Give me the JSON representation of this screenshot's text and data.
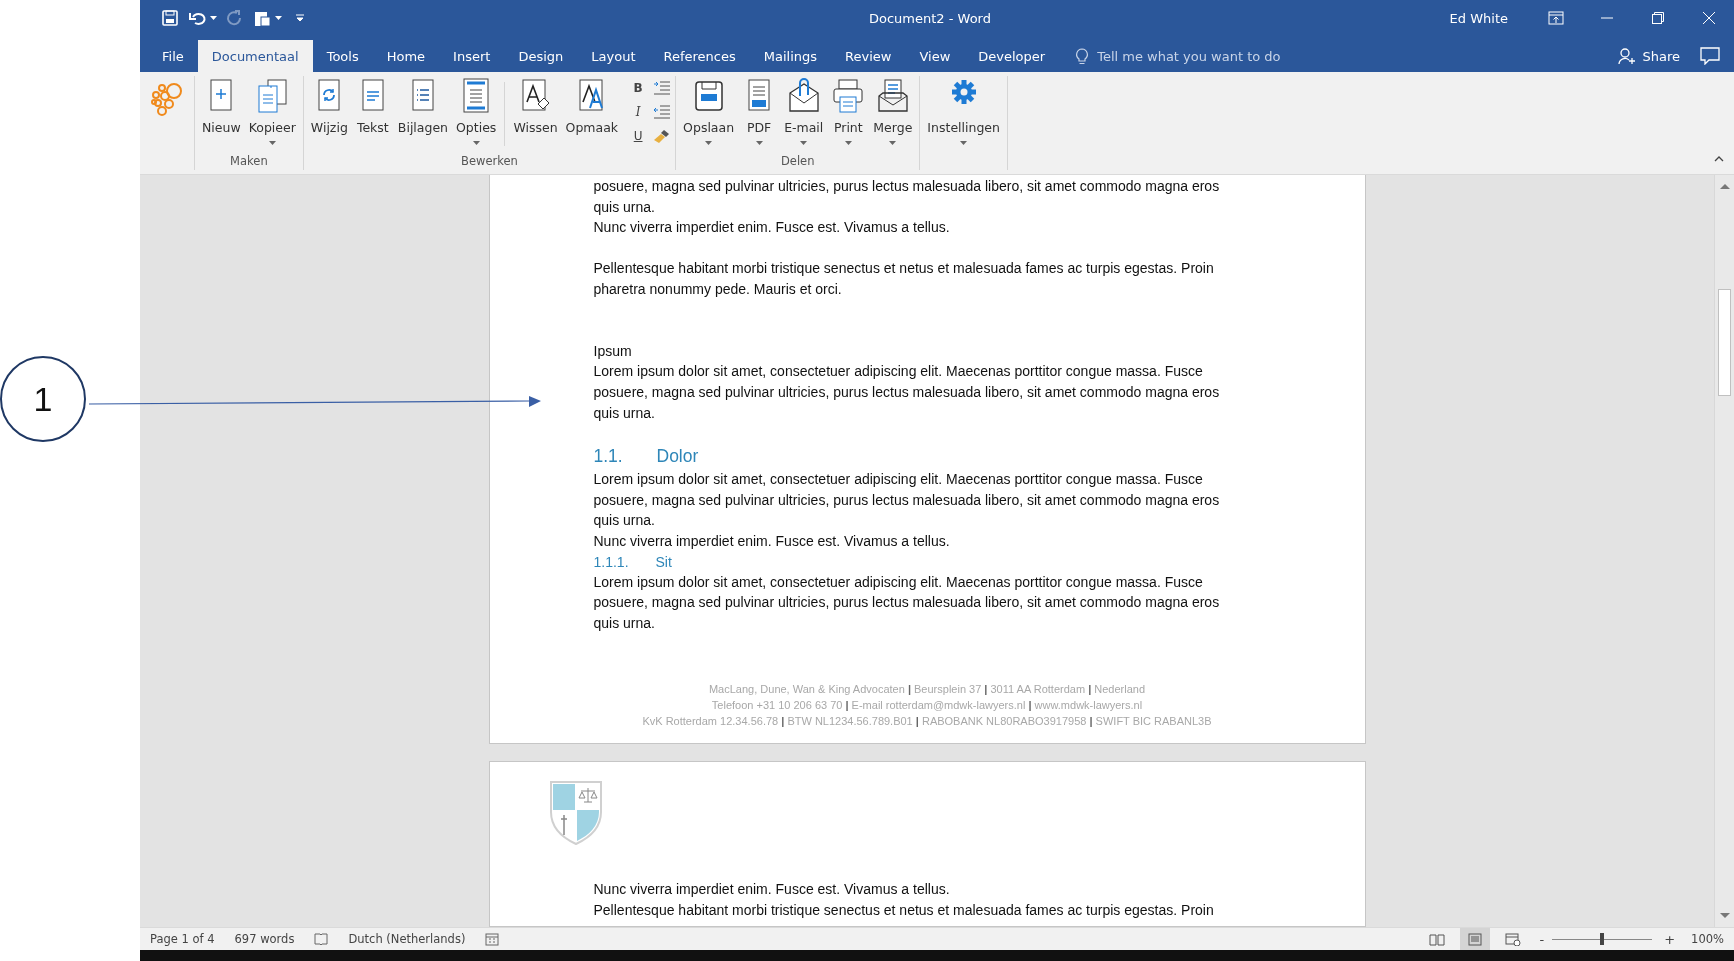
{
  "window": {
    "title": "Document2  -  Word",
    "user": "Ed White"
  },
  "quick_access": [
    {
      "kind": "save",
      "dropdown": false,
      "disabled": false
    },
    {
      "kind": "undo",
      "dropdown": true,
      "disabled": false
    },
    {
      "kind": "redo",
      "dropdown": false,
      "disabled": true
    },
    {
      "kind": "paste",
      "dropdown": true,
      "disabled": false
    },
    {
      "kind": "customize",
      "dropdown": false,
      "disabled": false
    }
  ],
  "tabs": [
    {
      "label": "File",
      "selected": false
    },
    {
      "label": "Documentaal",
      "selected": true
    },
    {
      "label": "Tools",
      "selected": false
    },
    {
      "label": "Home",
      "selected": false
    },
    {
      "label": "Insert",
      "selected": false
    },
    {
      "label": "Design",
      "selected": false
    },
    {
      "label": "Layout",
      "selected": false
    },
    {
      "label": "References",
      "selected": false
    },
    {
      "label": "Mailings",
      "selected": false
    },
    {
      "label": "Review",
      "selected": false
    },
    {
      "label": "View",
      "selected": false
    },
    {
      "label": "Developer",
      "selected": false
    }
  ],
  "tell_me": {
    "placeholder": "Tell me what you want to do"
  },
  "share": {
    "label": "Share"
  },
  "ribbon": {
    "groups": [
      {
        "items": [
          {
            "kind": "logo"
          }
        ]
      },
      {
        "label": "Maken",
        "items": [
          {
            "kind": "new",
            "label": "Nieuw",
            "dropdown": false
          },
          {
            "kind": "copy",
            "label": "Kopieer",
            "dropdown": true
          }
        ]
      },
      {
        "label": "Bewerken",
        "items": [
          {
            "kind": "modify",
            "label": "Wijzig",
            "dropdown": false
          },
          {
            "kind": "text",
            "label": "Tekst",
            "dropdown": false
          },
          {
            "kind": "attachments",
            "label": "Bijlagen",
            "dropdown": false
          },
          {
            "kind": "options",
            "label": "Opties",
            "dropdown": true
          },
          {
            "kind": "divider"
          },
          {
            "kind": "clear",
            "label": "Wissen",
            "dropdown": false
          },
          {
            "kind": "format",
            "label": "Opmaak",
            "dropdown": false
          },
          {
            "kind": "cluster",
            "rows": [
              [
                {
                  "kind": "bold",
                  "text": "B"
                },
                {
                  "kind": "indent"
                }
              ],
              [
                {
                  "kind": "italic",
                  "text": "I"
                },
                {
                  "kind": "outdent"
                }
              ],
              [
                {
                  "kind": "underline",
                  "text": "U"
                },
                {
                  "kind": "painter"
                }
              ]
            ]
          }
        ]
      },
      {
        "label": "Delen",
        "items": [
          {
            "kind": "save",
            "label": "Opslaan",
            "dropdown": true
          },
          {
            "kind": "pdf",
            "label": "PDF",
            "dropdown": true
          },
          {
            "kind": "email",
            "label": "E-mail",
            "dropdown": true
          },
          {
            "kind": "print",
            "label": "Print",
            "dropdown": true
          },
          {
            "kind": "merge",
            "label": "Merge",
            "dropdown": true
          }
        ]
      },
      {
        "items": [
          {
            "kind": "settings",
            "label": "Instellingen",
            "dropdown": true
          }
        ]
      }
    ]
  },
  "document": {
    "pages": [
      {
        "kind": "continued",
        "blocks": [
          {
            "kind": "paragraph",
            "lines": [
              "posuere, magna sed pulvinar ultricies, purus lectus malesuada libero, sit amet commodo magna eros",
              "quis urna."
            ]
          },
          {
            "kind": "paragraph",
            "lines": [
              "Nunc viverra imperdiet enim. Fusce est. Vivamus a tellus."
            ]
          },
          {
            "kind": "empty_line"
          },
          {
            "kind": "paragraph",
            "lines": [
              "Pellentesque habitant morbi tristique senectus et netus et malesuada fames ac turpis egestas. Proin",
              "pharetra nonummy pede. Mauris et orci."
            ]
          },
          {
            "kind": "empty_line"
          },
          {
            "kind": "empty_line"
          },
          {
            "kind": "paragraph",
            "lines": [
              "Ipsum"
            ]
          },
          {
            "kind": "paragraph",
            "lines": [
              "Lorem ipsum dolor sit amet, consectetuer adipiscing elit. Maecenas porttitor congue massa. Fusce",
              "posuere, magna sed pulvinar ultricies, purus lectus malesuada libero, sit amet commodo magna eros",
              "quis urna."
            ]
          },
          {
            "kind": "heading2",
            "number": "1.1.",
            "text": "Dolor"
          },
          {
            "kind": "paragraph",
            "lines": [
              "Lorem ipsum dolor sit amet, consectetuer adipiscing elit. Maecenas porttitor congue massa. Fusce",
              "posuere, magna sed pulvinar ultricies, purus lectus malesuada libero, sit amet commodo magna eros",
              "quis urna."
            ]
          },
          {
            "kind": "paragraph",
            "lines": [
              "Nunc viverra imperdiet enim. Fusce est. Vivamus a tellus."
            ]
          },
          {
            "kind": "heading3",
            "number": "1.1.1.",
            "text": "Sit"
          },
          {
            "kind": "paragraph",
            "lines": [
              "Lorem ipsum dolor sit amet, consectetuer adipiscing elit. Maecenas porttitor congue massa. Fusce",
              "posuere, magna sed pulvinar ultricies, purus lectus malesuada libero, sit amet commodo magna eros",
              "quis urna."
            ]
          }
        ],
        "footer": [
          "MacLang, Dune, Wan & King Advocaten **|** Beursplein 37 **|** 3011 AA  Rotterdam **|** Nederland",
          "Telefoon +31 10 206 63 70 **|** E-mail rotterdam@mdwk-lawyers.nl **|** www.mdwk-lawyers.nl",
          "KvK Rotterdam 12.34.56.78 **|** BTW NL1234.56.789.B01 **|** RABOBANK NL80RABO3917958 **|** SWIFT BIC RABANL3B"
        ]
      },
      {
        "kind": "letterhead",
        "blocks": [
          {
            "kind": "paragraph",
            "lines": [
              "Nunc viverra imperdiet enim. Fusce est. Vivamus a tellus."
            ]
          },
          {
            "kind": "paragraph",
            "lines": [
              "Pellentesque habitant morbi tristique senectus et netus et malesuada fames ac turpis egestas. Proin"
            ]
          }
        ]
      }
    ]
  },
  "status_bar": {
    "page": "Page 1 of 4",
    "words": "697 words",
    "language": "Dutch (Netherlands)",
    "views": [
      {
        "kind": "read",
        "selected": false
      },
      {
        "kind": "print",
        "selected": true
      },
      {
        "kind": "web",
        "selected": false
      }
    ],
    "zoom": {
      "minus": "-",
      "plus": "+",
      "level": 0.5,
      "percent": "100%"
    }
  },
  "callout": {
    "number": "1"
  }
}
